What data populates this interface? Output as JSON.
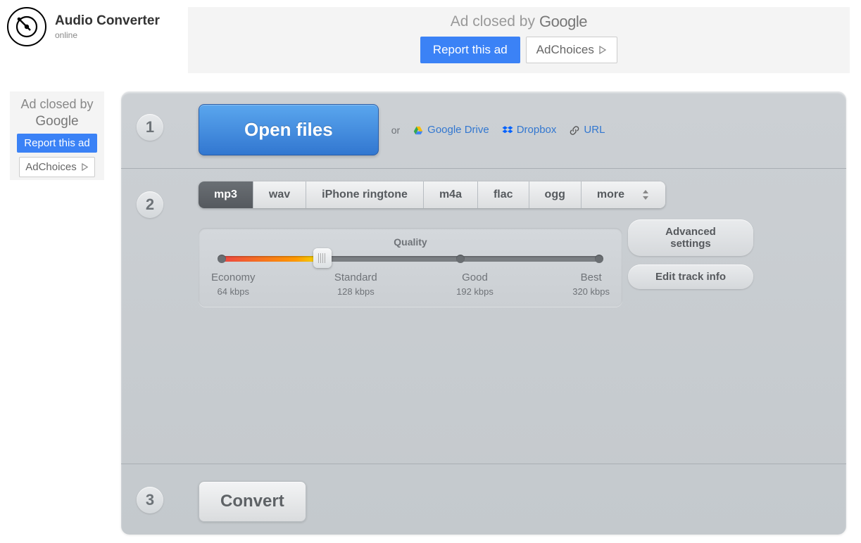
{
  "header": {
    "title": "Audio Converter",
    "subtitle": "online"
  },
  "ad": {
    "closed_text": "Ad closed by",
    "google": "Google",
    "report": "Report this ad",
    "adchoices": "AdChoices"
  },
  "step1": {
    "num": "1",
    "open_files": "Open files",
    "or": "or",
    "sources": {
      "gdrive": "Google Drive",
      "dropbox": "Dropbox",
      "url": "URL"
    }
  },
  "step2": {
    "num": "2",
    "formats": [
      "mp3",
      "wav",
      "iPhone ringtone",
      "m4a",
      "flac",
      "ogg",
      "more"
    ],
    "active_index": 0,
    "quality": {
      "title": "Quality",
      "levels": [
        {
          "label": "Economy",
          "rate": "64 kbps"
        },
        {
          "label": "Standard",
          "rate": "128 kbps"
        },
        {
          "label": "Good",
          "rate": "192 kbps"
        },
        {
          "label": "Best",
          "rate": "320 kbps"
        }
      ]
    },
    "advanced": "Advanced settings",
    "track_info": "Edit track info"
  },
  "step3": {
    "num": "3",
    "convert": "Convert"
  }
}
